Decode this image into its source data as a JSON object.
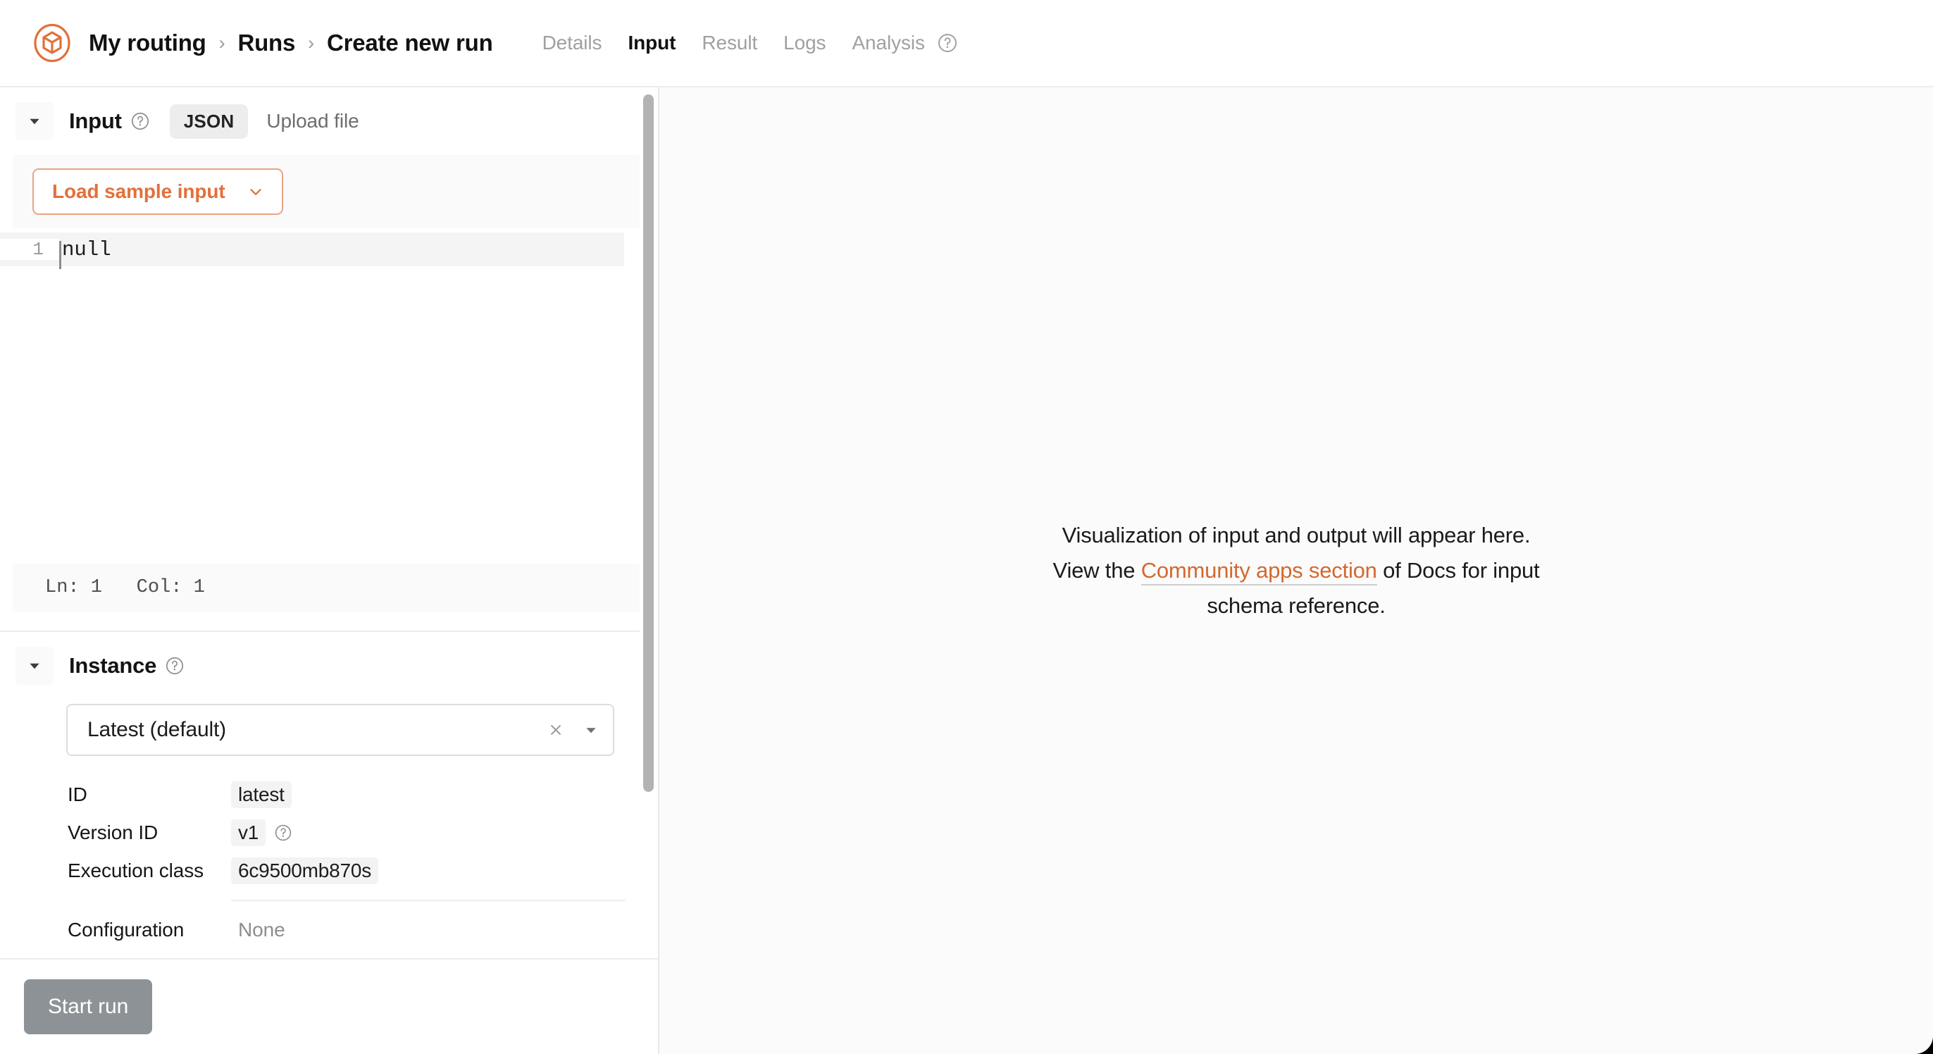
{
  "app": {
    "logo_icon": "cube-in-circle-logo",
    "accent_color": "#e2703a",
    "link_color": "#d4682f"
  },
  "header": {
    "breadcrumb": [
      {
        "label": "My routing"
      },
      {
        "label": "Runs"
      },
      {
        "label": "Create new run"
      }
    ],
    "separator": "›",
    "tabs": [
      {
        "label": "Details",
        "active": false
      },
      {
        "label": "Input",
        "active": true
      },
      {
        "label": "Result",
        "active": false
      },
      {
        "label": "Logs",
        "active": false
      },
      {
        "label": "Analysis",
        "active": false
      }
    ],
    "tabs_help_icon": "question-circle-icon"
  },
  "input_section": {
    "title": "Input",
    "help_icon": "question-circle-icon",
    "collapse_icon": "caret-down-icon",
    "format_chip": "JSON",
    "upload_link": "Upload file",
    "sample_button": "Load sample input",
    "sample_button_icon": "chevron-down-icon",
    "editor": {
      "line_number": "1",
      "line_text": "null"
    },
    "status": {
      "line": "Ln: 1",
      "col": "Col: 1",
      "combined": "Ln: 1   Col: 1"
    }
  },
  "instance_section": {
    "title": "Instance",
    "help_icon": "question-circle-icon",
    "collapse_icon": "caret-down-icon",
    "select": {
      "value": "Latest (default)",
      "clear_icon": "close-icon",
      "dropdown_icon": "caret-down-icon"
    },
    "details": [
      {
        "key": "ID",
        "value": "latest",
        "chip": true,
        "help": false
      },
      {
        "key": "Version ID",
        "value": "v1",
        "chip": true,
        "help": true
      },
      {
        "key": "Execution class",
        "value": "6c9500mb870s",
        "chip": true,
        "help": false
      }
    ],
    "configuration": {
      "key": "Configuration",
      "value": "None"
    }
  },
  "footer": {
    "start_button": "Start run"
  },
  "right_panel": {
    "message_line1": "Visualization of input and output will appear here.",
    "message_line2_prefix": "View the ",
    "message_link": "Community apps section",
    "message_line2_suffix": " of Docs for input",
    "message_line3": "schema reference."
  }
}
